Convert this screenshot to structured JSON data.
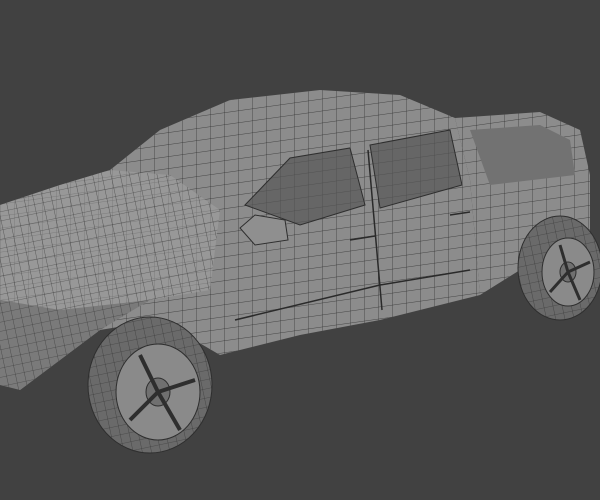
{
  "scene": {
    "subject": "pickup-truck-wireframe-model",
    "colors": {
      "background": "#414141",
      "body": "#8c8c8c",
      "body_light": "#a2a2a2",
      "body_dark": "#6e6e6e",
      "window": "#5f5f5f",
      "tire": "#6a6a6a",
      "wire": "#2e2e2e"
    }
  }
}
